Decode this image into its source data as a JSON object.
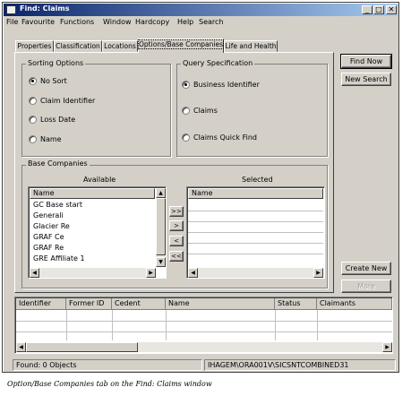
{
  "window": {
    "title": "Find: Claims",
    "controls": {
      "minimize": "_",
      "maximize": "□",
      "close": "✕"
    }
  },
  "menubar": {
    "items": [
      "File",
      "Favourite",
      "Functions",
      "Window",
      "Hardcopy",
      "Help",
      "Search"
    ]
  },
  "tabs": [
    {
      "label": "Properties",
      "active": false
    },
    {
      "label": "Classification",
      "active": false
    },
    {
      "label": "Locations",
      "active": false
    },
    {
      "label": "Options/Base Companies",
      "active": true
    },
    {
      "label": "Life and Health",
      "active": false
    }
  ],
  "sorting_options": {
    "legend": "Sorting Options",
    "options": [
      {
        "label": "No Sort",
        "selected": true
      },
      {
        "label": "Claim Identifier",
        "selected": false
      },
      {
        "label": "Loss Date",
        "selected": false
      },
      {
        "label": "Name",
        "selected": false
      }
    ]
  },
  "query_specification": {
    "legend": "Query Specification",
    "options": [
      {
        "label": "Business Identifier",
        "selected": true
      },
      {
        "label": "Claims",
        "selected": false
      },
      {
        "label": "Claims Quick Find",
        "selected": false
      }
    ]
  },
  "base_companies": {
    "legend": "Base Companies",
    "available_label": "Available",
    "selected_label": "Selected",
    "available_column": "Name",
    "selected_column": "Name",
    "available_items": [
      "GC Base start",
      "Generali",
      "Glacier Re",
      "GRAF Ce",
      "GRAF Re",
      "GRE Affiliate 1"
    ],
    "move_buttons": [
      ">>",
      ">",
      "<",
      "<<"
    ]
  },
  "side_buttons": {
    "find_now": "Find Now",
    "new_search": "New Search",
    "create_new": "Create New",
    "more": "More"
  },
  "results_grid": {
    "columns": [
      "Identifier",
      "Former ID",
      "Cedent",
      "Name",
      "Status",
      "Claimants"
    ]
  },
  "statusbar": {
    "found": "Found: 0 Objects",
    "connection": "IHAGEM\\ORA001V\\SICSNTCOMBINED31"
  },
  "caption": "Option/Base Companies tab on the Find: Claims window",
  "colors": {
    "title_start": "#0a246a",
    "title_end": "#a6caf0",
    "face": "#d4d0c8"
  }
}
